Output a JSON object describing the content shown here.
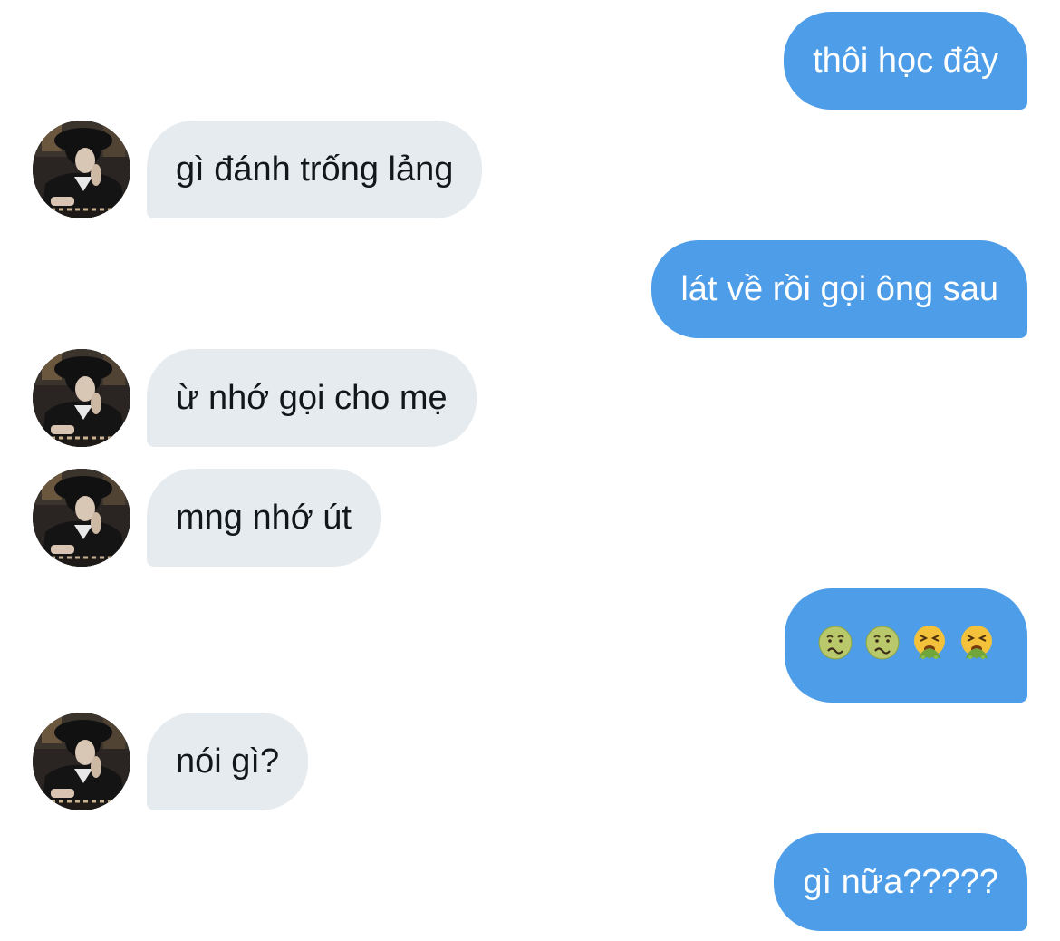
{
  "conversation": {
    "messages": [
      {
        "direction": "sent",
        "text": "thôi học đây"
      },
      {
        "direction": "received",
        "text": "gì đánh trống lảng"
      },
      {
        "direction": "sent",
        "text": "lát về rồi gọi ông sau"
      },
      {
        "direction": "received",
        "text": "ừ nhớ gọi cho mẹ"
      },
      {
        "direction": "received",
        "text": "mng nhớ út"
      },
      {
        "direction": "sent",
        "emojis": [
          "nauseated-face",
          "nauseated-face",
          "vomiting-face",
          "vomiting-face"
        ]
      },
      {
        "direction": "received",
        "text": "nói gì?"
      },
      {
        "direction": "sent",
        "text": "gì nữa?????"
      }
    ]
  },
  "colors": {
    "sent_bubble": "#4d9de8",
    "received_bubble": "#e6ebef",
    "sent_text": "#ffffff",
    "received_text": "#14171a"
  }
}
